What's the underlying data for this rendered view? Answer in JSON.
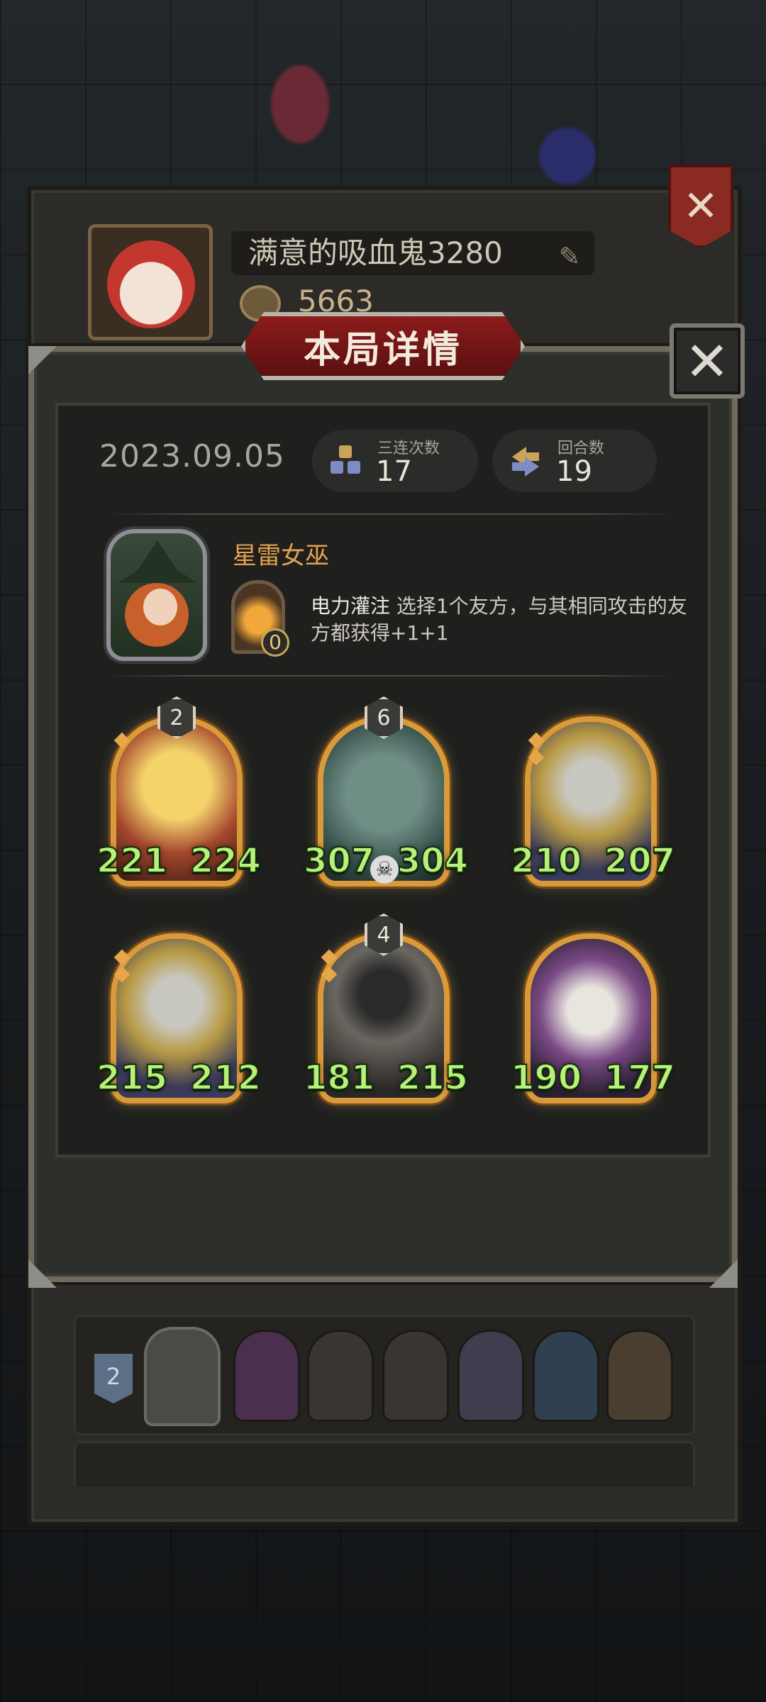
{
  "profile": {
    "player_name": "满意的吸血鬼3280",
    "coins": "5663"
  },
  "dialog": {
    "title": "本局详情",
    "date": "2023.09.05",
    "stats": [
      {
        "label": "三连次数",
        "value": "17",
        "icon": "triple-merge-icon"
      },
      {
        "label": "回合数",
        "value": "19",
        "icon": "round-cycle-icon"
      }
    ],
    "hero": {
      "name": "星雷女巫",
      "skill_cost": "0",
      "skill_name": "电力灌注",
      "skill_desc": " 选择1个友方，与其相同攻击的友方都获得+1+1"
    },
    "units": [
      {
        "tier": "2",
        "attack": "221",
        "health": "224",
        "palette": "#c0412c"
      },
      {
        "tier": "6",
        "attack": "307",
        "health": "304",
        "palette": "#5b7a73"
      },
      {
        "tier": "",
        "attack": "210",
        "health": "207",
        "palette": "#7a6a3a"
      },
      {
        "tier": "",
        "attack": "215",
        "health": "212",
        "palette": "#7a6a3a"
      },
      {
        "tier": "4",
        "attack": "181",
        "health": "215",
        "palette": "#4b4b4a"
      },
      {
        "tier": "",
        "attack": "190",
        "health": "177",
        "palette": "#6a4a78"
      }
    ]
  },
  "history": {
    "rank": "2"
  }
}
